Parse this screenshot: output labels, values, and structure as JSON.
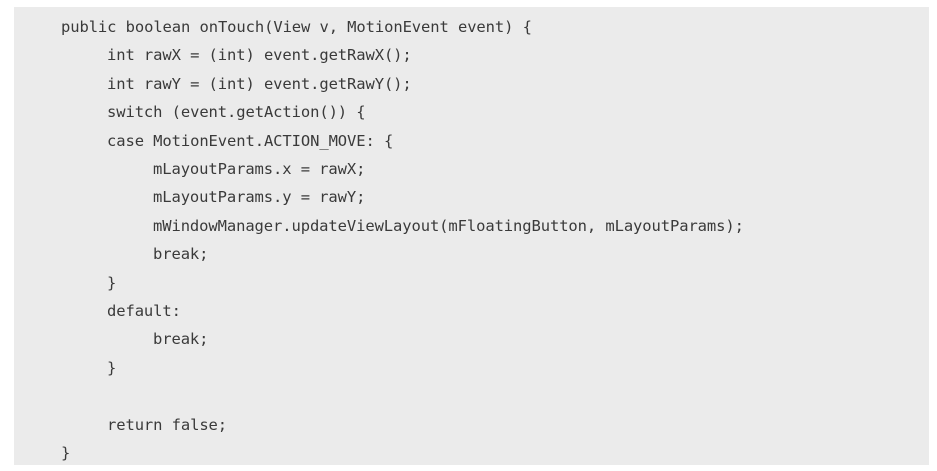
{
  "code": {
    "lines": [
      {
        "indent": 0,
        "text": "public boolean onTouch(View v, MotionEvent event) {"
      },
      {
        "indent": 1,
        "text": "int rawX = (int) event.getRawX();"
      },
      {
        "indent": 1,
        "text": "int rawY = (int) event.getRawY();"
      },
      {
        "indent": 1,
        "text": "switch (event.getAction()) {"
      },
      {
        "indent": 1,
        "text": "case MotionEvent.ACTION_MOVE: {"
      },
      {
        "indent": 2,
        "text": "mLayoutParams.x = rawX;"
      },
      {
        "indent": 2,
        "text": "mLayoutParams.y = rawY;"
      },
      {
        "indent": 2,
        "text": "mWindowManager.updateViewLayout(mFloatingButton, mLayoutParams);"
      },
      {
        "indent": 2,
        "text": "break;"
      },
      {
        "indent": 1,
        "text": "}"
      },
      {
        "indent": 1,
        "text": "default:"
      },
      {
        "indent": 2,
        "text": "break;"
      },
      {
        "indent": 1,
        "text": "}"
      },
      {
        "indent": 0,
        "text": ""
      },
      {
        "indent": 1,
        "text": "return false;"
      },
      {
        "indent": 0,
        "text": "}"
      }
    ]
  }
}
